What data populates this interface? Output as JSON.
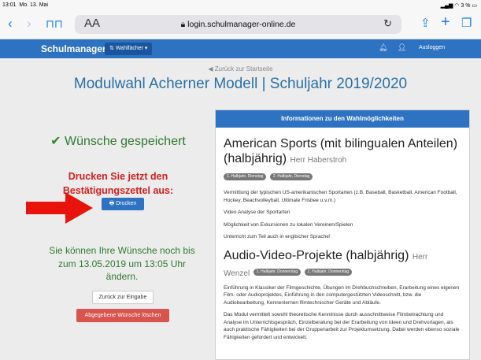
{
  "status": {
    "time": "13:01",
    "date": "Mo. 13. Mai",
    "battery": "3 %"
  },
  "browser": {
    "url": "login.schulmanager-online.de",
    "text_size_label": "AA"
  },
  "navbar": {
    "brand": "Schulmanager",
    "menu_label": "Wahlfächer",
    "logout_label": "Ausloggen"
  },
  "page": {
    "back_link": "Zurück zur Startseite",
    "title": "Modulwahl Acherner Modell | Schuljahr 2019/2020"
  },
  "left": {
    "saved_text": "Wünsche gespeichert",
    "print_heading_line1": "Drucken Sie jetzt den",
    "print_heading_line2": "Bestätigungszettel aus:",
    "print_button": "Drucken",
    "change_line1": "Sie können Ihre Wünsche noch bis",
    "change_line2": "zum 13.05.2019 um 13:05 Uhr",
    "change_line3": "ändern.",
    "back_to_input": "Zurück zur Eingabe",
    "delete_button": "Abgegebene Wünsche löschen"
  },
  "panel": {
    "heading": "Informationen zu den Wahlmöglichkeiten",
    "courses": [
      {
        "title": "American Sports (mit bilingualen Anteilen) (halbjährig)",
        "teacher": "Herr Haberstroh",
        "badges": [
          "1. Halbjahr, Dienstag",
          "2. Halbjahr, Dienstag"
        ],
        "paragraphs": [
          "Vermittlung der typischen US-amerikanischen Sportarten (z.B. Baseball, Basketball, American Football, Hockey, Beachvolleyball, Ultimate Frisbee u.v.m.)",
          "Video Analyse der Sportarten",
          "Möglichkeit von Exkursionen zu lokalen Vereinen/Spielen",
          "Unterricht zum Teil auch in englischer Sprache!"
        ]
      },
      {
        "title": "Audio-Video-Projekte (halbjährig)",
        "teacher_part1": "Herr",
        "teacher_part2": "Wenzel",
        "badges": [
          "1. Halbjahr, Donnerstag",
          "2. Halbjahr, Donnerstag"
        ],
        "paragraphs": [
          "Einführung in Klassiker der Filmgeschichte, Übungen im Drehbuchschreiben, Erarbeitung eines eigenen Film- oder Audioprojektes, Einführung in den computergestützten Videoschnitt, bzw. die Audiobearbeitung, Kennenlernen filmtechnischer Geräte und Abläufe.",
          "Das Modul vermittelt sowohl theoretische Kenntnisse durch ausschnittweise Filmbetrachtung und Analyse im Unterrichtsgespräch, Einzelberatung bei der Erarbeitung von Ideen und Drehvorlagen, als auch praktische Fähigkeiten bei der Gruppenarbeit zur Projektumsetzung. Dabei werden ebenso soziale Fähigkeiten gefordert und entwickelt."
        ]
      }
    ]
  },
  "colors": {
    "brand_blue": "#2e72c2",
    "success_green": "#2f7a2f",
    "alert_red": "#d42020",
    "danger_button": "#d9534f"
  }
}
